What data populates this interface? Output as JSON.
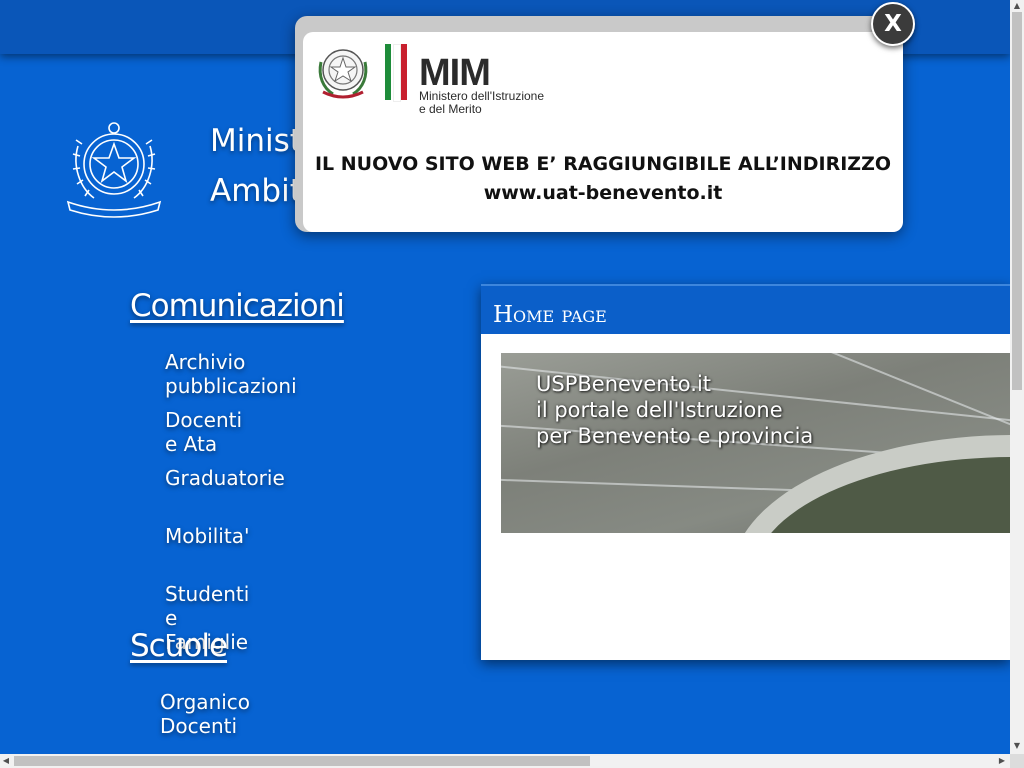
{
  "header": {
    "title_line1": "Minist",
    "title_line2": "Ambit"
  },
  "nav": {
    "sections": [
      {
        "heading": "Comunicazioni",
        "items": [
          "Archivio pubblicazioni",
          "Docenti e Ata",
          "Graduatorie",
          "Mobilita'",
          "Studenti e Famiglie"
        ]
      },
      {
        "heading": "Scuole",
        "items": [
          "Organico Docenti"
        ]
      }
    ]
  },
  "panel": {
    "title": "Home page",
    "banner_text": "USPBenevento.it\nil portale dell'Istruzione\nper Benevento e provincia"
  },
  "popup": {
    "logo_text": "MIM",
    "logo_sub_line1": "Ministero dell'Istruzione",
    "logo_sub_line2": "e del Merito",
    "message": "IL NUOVO SITO WEB E’ RAGGIUNGIBILE ALL’INDIRIZZO",
    "url": "www.uat-benevento.it",
    "close_label": "X"
  },
  "colors": {
    "page_bg": "#0763d2",
    "panel_header": "#0b5fc9",
    "flag_green": "#1e8c3a",
    "flag_red": "#c8202e"
  }
}
